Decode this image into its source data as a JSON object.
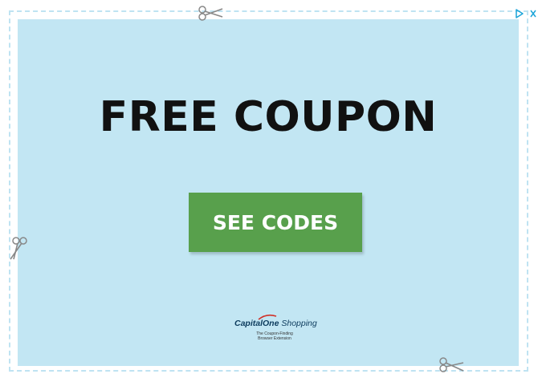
{
  "ad": {
    "headline": "FREE COUPON",
    "cta_label": "SEE CODES",
    "brand": {
      "name_part1": "Capital",
      "name_part2": "One",
      "name_part3": "Shopping",
      "tagline_line1": "The Coupon-Finding",
      "tagline_line2": "Browser Extension"
    }
  },
  "ad_controls": {
    "adchoices_icon": "adchoices-icon",
    "close_icon": "close-icon"
  },
  "colors": {
    "coupon_background": "#c2e6f3",
    "border_dash": "#bfe3f2",
    "cta_background": "#58a04c",
    "headline": "#111111",
    "ad_controls": "#1aa4d8"
  },
  "decorations": [
    "scissors-icon",
    "scissors-icon",
    "scissors-icon"
  ]
}
